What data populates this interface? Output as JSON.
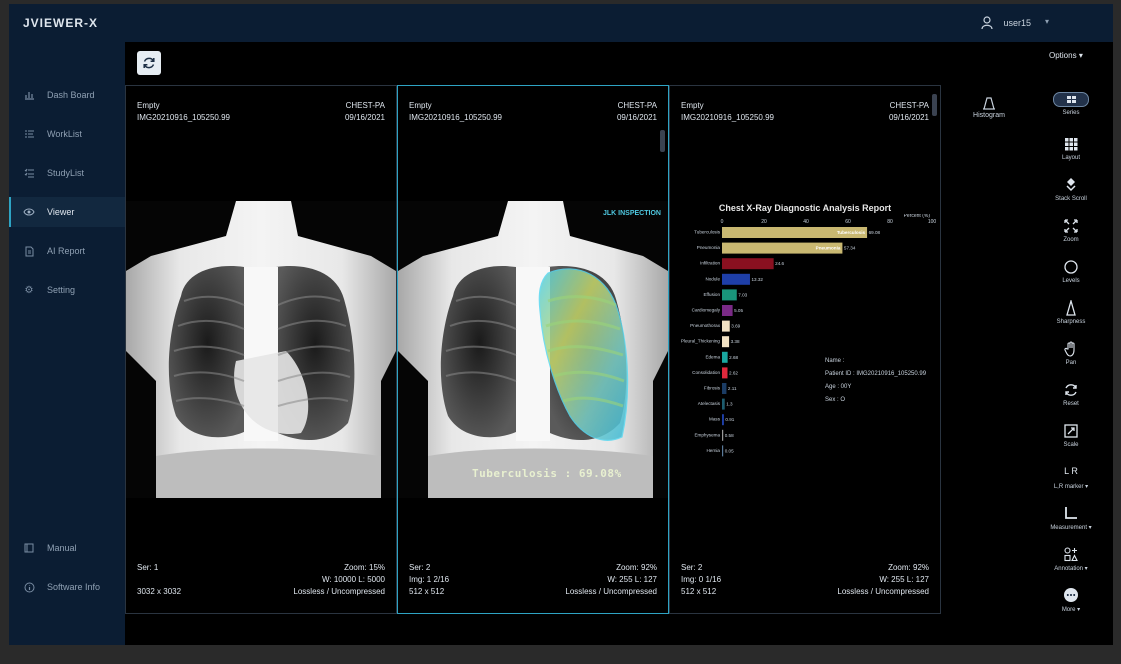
{
  "app": {
    "title": "JVIEWER-X",
    "user": "user15"
  },
  "sidebar": {
    "items": [
      {
        "label": "Dash Board",
        "icon": "chart-icon"
      },
      {
        "label": "WorkList",
        "icon": "list-icon"
      },
      {
        "label": "StudyList",
        "icon": "list-check-icon"
      },
      {
        "label": "Viewer",
        "icon": "eye-icon",
        "active": true
      },
      {
        "label": "AI Report",
        "icon": "document-icon"
      },
      {
        "label": "Setting",
        "icon": "gear-icon"
      }
    ],
    "bottom": [
      {
        "label": "Manual",
        "icon": "book-icon"
      },
      {
        "label": "Software Info",
        "icon": "info-icon"
      }
    ]
  },
  "toolbar": {
    "options_label": "Options"
  },
  "viewports": [
    {
      "top_left": [
        "Empty",
        "IMG20210916_105250.99"
      ],
      "top_right": [
        "CHEST-PA",
        "09/16/2021"
      ],
      "bottom_left": [
        "Ser: 1",
        "",
        "3032 x 3032"
      ],
      "bottom_right": [
        "Zoom: 15%",
        "W: 10000 L: 5000",
        "Lossless / Uncompressed"
      ]
    },
    {
      "top_left": [
        "Empty",
        "IMG20210916_105250.99"
      ],
      "top_right": [
        "CHEST-PA",
        "09/16/2021"
      ],
      "bottom_left": [
        "Ser: 2",
        "Img: 1 2/16",
        "512 x 512"
      ],
      "bottom_right": [
        "Zoom: 92%",
        "W: 255 L: 127",
        "Lossless / Uncompressed"
      ],
      "logo_text": "JLK INSPECTION",
      "finding_label": "Tuberculosis : 69.08%"
    },
    {
      "top_left": [
        "Empty",
        "IMG20210916_105250.99"
      ],
      "top_right": [
        "CHEST-PA",
        "09/16/2021"
      ],
      "bottom_left": [
        "Ser: 2",
        "Img: 0 1/16",
        "512 x 512"
      ],
      "bottom_right": [
        "Zoom: 92%",
        "W: 255 L: 127",
        "Lossless / Uncompressed"
      ],
      "report_title": "Chest X-Ray Diagnostic Analysis Report",
      "patient": [
        "Name :",
        "Patient ID : IMG20210916_105250.99",
        "Age : 00Y",
        "Sex : O"
      ]
    }
  ],
  "chart_data": {
    "type": "bar",
    "orientation": "horizontal",
    "title": "Chest X-Ray Diagnostic Analysis Report",
    "xlabel": "Percent (%)",
    "xlim": [
      0,
      100
    ],
    "xticks": [
      "0",
      "20",
      "40",
      "60",
      "80",
      "100"
    ],
    "categories": [
      "Tuberculosis",
      "Pneumonia",
      "Infiltration",
      "Nodule",
      "Effusion",
      "Cardiomegaly",
      "Pneumothorax",
      "Pleural_Thickening",
      "Edema",
      "Consolidation",
      "Fibrosis",
      "Atelectasis",
      "Mass",
      "Emphysema",
      "Hernia"
    ],
    "values": [
      69.08,
      57.34,
      24.6,
      13.32,
      7.03,
      5.05,
      3.69,
      3.38,
      2.68,
      2.62,
      2.11,
      1.3,
      0.91,
      0.58,
      0.05
    ],
    "value_labels": [
      "69.08",
      "57.34",
      "24.6",
      "13.32",
      "7.03",
      "5.05",
      "3.69",
      "3.38",
      "2.68",
      "2.62",
      "2.11",
      "1.3",
      "0.91",
      "0.58",
      "0.05"
    ],
    "inline_labels": [
      "Tuberculosis",
      "Pneumonia"
    ],
    "colors": [
      "#c9b871",
      "#c9b871",
      "#8a1020",
      "#1e3fa8",
      "#19957a",
      "#7a2a86",
      "#f2e2c4",
      "#f2e2c4",
      "#1aa7a0",
      "#e0283c",
      "#1b3c64",
      "#1d5c6e",
      "#1e3fa8",
      "#9a9a9a",
      "#5a7a9a"
    ]
  },
  "tools": [
    {
      "label": "Histogram",
      "icon": "histogram-icon"
    },
    {
      "label": "Series",
      "icon": "series-icon"
    },
    {
      "label": "Layout",
      "icon": "layout-grid-icon"
    },
    {
      "label": "Stack Scroll",
      "icon": "stack-scroll-icon"
    },
    {
      "label": "Zoom",
      "icon": "zoom-icon"
    },
    {
      "label": "Levels",
      "icon": "levels-icon"
    },
    {
      "label": "Sharpness",
      "icon": "sharpness-icon"
    },
    {
      "label": "Pan",
      "icon": "pan-hand-icon"
    },
    {
      "label": "Reset",
      "icon": "reset-icon"
    },
    {
      "label": "Scale",
      "icon": "scale-icon"
    },
    {
      "label": "L,R marker",
      "icon": "lr-marker-icon",
      "glyph": "L R"
    },
    {
      "label": "Measurement",
      "icon": "measurement-icon"
    },
    {
      "label": "Annotation",
      "icon": "annotation-icon"
    },
    {
      "label": "More",
      "icon": "more-icon"
    }
  ]
}
